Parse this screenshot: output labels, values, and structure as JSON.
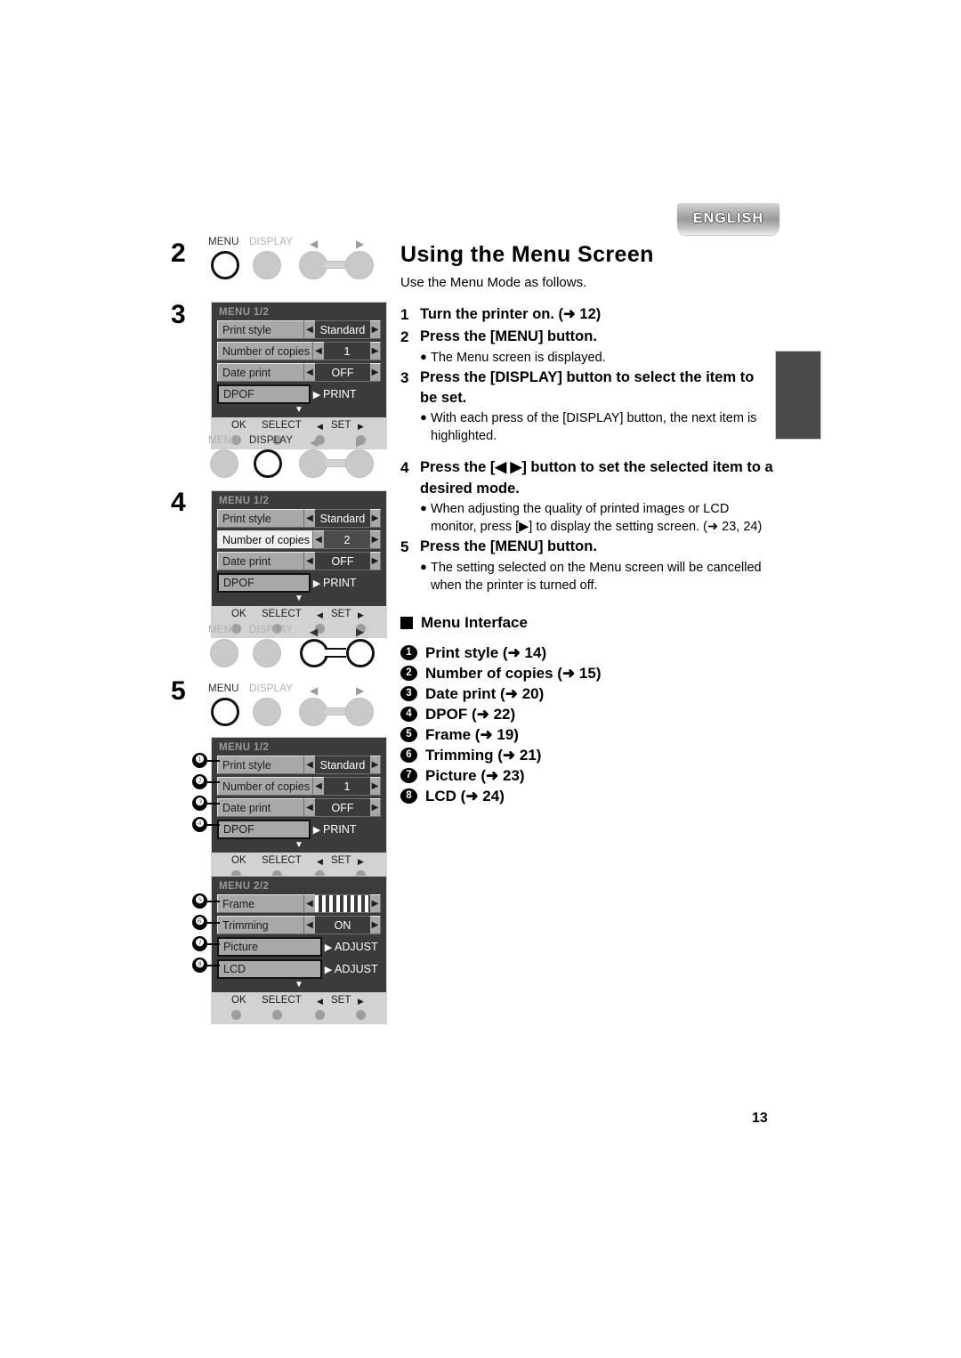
{
  "badge": {
    "label": "ENGLISH"
  },
  "page": {
    "number": "13"
  },
  "header": {
    "title": "Using the Menu Screen",
    "subtitle": "Use the Menu Mode as follows."
  },
  "steps": [
    {
      "num": "1",
      "head": "Turn the printer on. (➜ 12)",
      "bullets": []
    },
    {
      "num": "2",
      "head": "Press the [MENU] button.",
      "bullets": [
        "The Menu screen is displayed."
      ]
    },
    {
      "num": "3",
      "head": "Press the [DISPLAY] button to select the item to be set.",
      "bullets": [
        "With each press of the [DISPLAY] button, the next item is highlighted."
      ]
    },
    {
      "num": "4",
      "head": "Press the [◀ ▶] button to set the selected item to a desired mode.",
      "bullets": [
        "When adjusting the quality of printed images or LCD monitor, press [▶] to display the setting screen. (➜ 23, 24)"
      ]
    },
    {
      "num": "5",
      "head": "Press the [MENU] button.",
      "bullets": [
        "The setting selected on the Menu screen will be cancelled when the printer is turned off."
      ]
    }
  ],
  "menu_interface": {
    "title": "Menu Interface",
    "items": [
      {
        "num": "❶",
        "label": "Print style (➜ 14)"
      },
      {
        "num": "❷",
        "label": "Number of copies (➜ 15)"
      },
      {
        "num": "❸",
        "label": "Date print (➜ 20)"
      },
      {
        "num": "❹",
        "label": "DPOF (➜ 22)"
      },
      {
        "num": "❺",
        "label": "Frame (➜ 19)"
      },
      {
        "num": "❻",
        "label": "Trimming (➜ 21)"
      },
      {
        "num": "❼",
        "label": "Picture (➜ 23)"
      },
      {
        "num": "❽",
        "label": "LCD (➜ 24)"
      }
    ]
  },
  "left_column": {
    "step_markers": [
      "2",
      "3",
      "4",
      "5"
    ],
    "keys": {
      "menu_label": "MENU",
      "display_label": "DISPLAY",
      "left_arrow": "◀",
      "right_arrow": "▶"
    },
    "keyrows": [
      {
        "id": "keyrow-step2",
        "active": "menu"
      },
      {
        "id": "keyrow-step3",
        "active": "display"
      },
      {
        "id": "keyrow-step4",
        "active": "arrows"
      },
      {
        "id": "keyrow-step5",
        "active": "menu"
      }
    ],
    "panels": [
      {
        "id": "panel-step3",
        "title": "MENU  1/2",
        "rows": [
          {
            "name": "Print style",
            "value": "Standard",
            "type": "value",
            "highlight": false
          },
          {
            "name": "Number of copies",
            "value": "1",
            "type": "value",
            "highlight": false
          },
          {
            "name": "Date print",
            "value": "OFF",
            "type": "value",
            "highlight": false
          },
          {
            "name": "DPOF",
            "value": "PRINT",
            "type": "action",
            "highlight": false
          }
        ]
      },
      {
        "id": "panel-step4",
        "title": "MENU  1/2",
        "rows": [
          {
            "name": "Print style",
            "value": "Standard",
            "type": "value",
            "highlight": false
          },
          {
            "name": "Number of copies",
            "value": "2",
            "type": "value",
            "highlight": true
          },
          {
            "name": "Date print",
            "value": "OFF",
            "type": "value",
            "highlight": false
          },
          {
            "name": "DPOF",
            "value": "PRINT",
            "type": "action",
            "highlight": false
          }
        ]
      },
      {
        "id": "panel-menu-1of2",
        "title": "MENU  1/2",
        "rows": [
          {
            "name": "Print style",
            "value": "Standard",
            "type": "value",
            "highlight": false
          },
          {
            "name": "Number of copies",
            "value": "1",
            "type": "value",
            "highlight": false
          },
          {
            "name": "Date print",
            "value": "OFF",
            "type": "value",
            "highlight": false
          },
          {
            "name": "DPOF",
            "value": "PRINT",
            "type": "action",
            "highlight": false
          }
        ]
      },
      {
        "id": "panel-menu-2of2",
        "title": "MENU  2/2",
        "rows": [
          {
            "name": "Frame",
            "value": "",
            "type": "pattern",
            "highlight": false
          },
          {
            "name": "Trimming",
            "value": "ON",
            "type": "value",
            "highlight": false
          },
          {
            "name": "Picture",
            "value": "ADJUST",
            "type": "action",
            "highlight": false
          },
          {
            "name": "LCD",
            "value": "ADJUST",
            "type": "action",
            "highlight": false
          }
        ]
      }
    ],
    "footer": {
      "ok": "OK",
      "select": "SELECT",
      "set": "SET",
      "left_caret": "◀",
      "right_caret": "▶"
    },
    "callouts_panel3": [
      "❶",
      "❷",
      "❸",
      "❹"
    ],
    "callouts_panel4": [
      "❺",
      "❻",
      "❼",
      "❽"
    ]
  }
}
